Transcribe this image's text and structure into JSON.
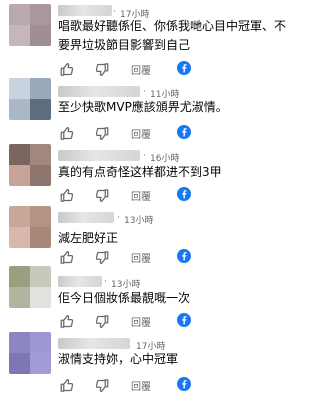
{
  "comments": [
    {
      "time": "17小時",
      "text": "唱歌最好聽係佢、你係我哋心目中冠軍、不要畀垃圾節目影響到自己",
      "reply_label": "回覆",
      "avatar_colors": [
        "#b9a9ae",
        "#a9979d",
        "#c4b6ba",
        "#9f8f95"
      ]
    },
    {
      "time": "11小時",
      "text": "至少快歌MVP應該頒畀尤淑情。",
      "reply_label": "回覆",
      "avatar_colors": [
        "#c9d3e0",
        "#9aa9bb",
        "#aab7c6",
        "#5d6d80"
      ]
    },
    {
      "time": "16小時",
      "text": "真的有点奇怪这样都进不到3甲",
      "reply_label": "回覆",
      "avatar_colors": [
        "#7a6660",
        "#a08880",
        "#c7a495",
        "#8d766e"
      ]
    },
    {
      "time": "13小時",
      "text": "減左肥好正",
      "reply_label": "回覆",
      "avatar_colors": [
        "#c9a798",
        "#b69284",
        "#d7b8aa",
        "#a78778"
      ]
    },
    {
      "time": "13小時",
      "text": "佢今日個妝係最靚嘅一次",
      "reply_label": "回覆",
      "avatar_colors": [
        "#9aa07f",
        "#c8c8bd",
        "#b0b5a0",
        "#e2e2dc"
      ]
    },
    {
      "time": "17小時",
      "text": "淑情支持妳，心中冠軍",
      "reply_label": "回覆",
      "avatar_colors": [
        "#8c87c4",
        "#9d97d3",
        "#7d77b6",
        "#a19cd6"
      ]
    }
  ],
  "colors": {
    "meta_text": "#65676b",
    "comment_text": "#050505",
    "facebook_blue": "#1877f2"
  }
}
